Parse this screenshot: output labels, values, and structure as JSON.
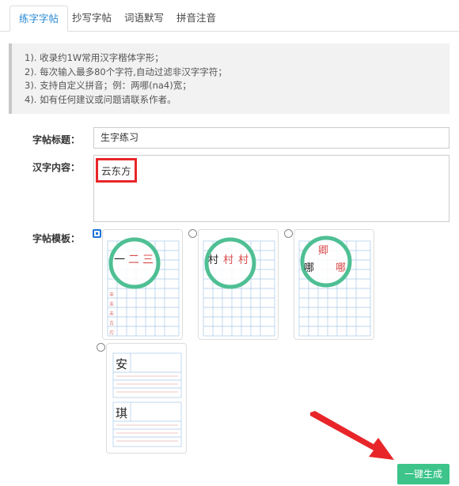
{
  "tabs": [
    {
      "label": "练字字帖",
      "active": true
    },
    {
      "label": "抄写字帖",
      "active": false
    },
    {
      "label": "词语默写",
      "active": false
    },
    {
      "label": "拼音注音",
      "active": false
    }
  ],
  "notice": [
    "1). 收录约1W常用汉字楷体字形；",
    "2). 每次输入最多80个字符,自动过滤非汉字字符；",
    "3). 支持自定义拼音；例：两哪(na4)宽；",
    "4). 如有任何建议或问题请联系作者。"
  ],
  "form": {
    "title_label": "字帖标题：",
    "title_value": "生字练习",
    "content_label": "汉字内容：",
    "content_value": "云东方",
    "template_label": "字帖模板："
  },
  "templates": [
    {
      "selected": true,
      "chars": [
        "一",
        "二",
        "三"
      ]
    },
    {
      "selected": false,
      "chars": [
        "村",
        "村",
        "村"
      ]
    },
    {
      "selected": false,
      "chars": [
        "哪",
        "卿",
        "哪"
      ]
    },
    {
      "selected": false,
      "chars": [
        "安",
        "琪"
      ]
    }
  ],
  "generate_button": "一键生成",
  "colors": {
    "accent": "#2a8bd5",
    "button": "#3cc48a",
    "highlight": "#e8262a",
    "magnifier": "#4fbf94"
  }
}
